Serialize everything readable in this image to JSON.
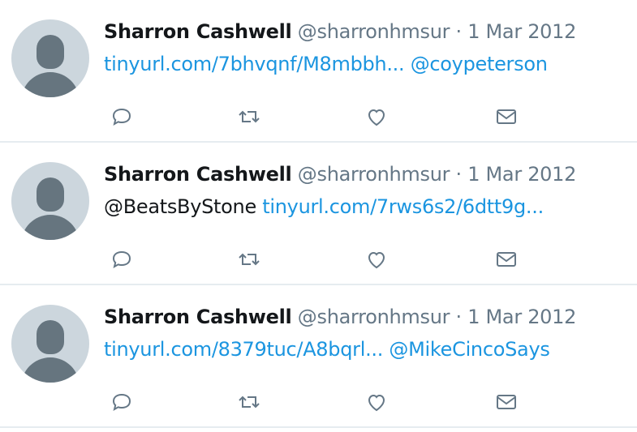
{
  "tweets": [
    {
      "name": "Sharron Cashwell",
      "handle": "@sharronhmsur",
      "separator": "·",
      "date": "1 Mar 2012",
      "text_parts": [
        {
          "text": "tinyurl.com/7bhvqnf/M8mbbh...",
          "type": "link"
        },
        {
          "text": " ",
          "type": "space"
        },
        {
          "text": "@coypeterson",
          "type": "link"
        }
      ]
    },
    {
      "name": "Sharron Cashwell",
      "handle": "@sharronhmsur",
      "separator": "·",
      "date": "1 Mar 2012",
      "text_parts": [
        {
          "text": "@BeatsByStone",
          "type": "plain"
        },
        {
          "text": "  ",
          "type": "space"
        },
        {
          "text": "tinyurl.com/7rws6s2/6dtt9g...",
          "type": "link"
        }
      ]
    },
    {
      "name": "Sharron Cashwell",
      "handle": "@sharronhmsur",
      "separator": "·",
      "date": "1 Mar 2012",
      "text_parts": [
        {
          "text": "tinyurl.com/8379tuc/A8bqrl...",
          "type": "link"
        },
        {
          "text": " ",
          "type": "space"
        },
        {
          "text": "@MikeCincoSays",
          "type": "link"
        }
      ]
    }
  ],
  "actions": {
    "reply_icon": "reply-icon",
    "retweet_icon": "retweet-icon",
    "like_icon": "heart-icon",
    "message_icon": "mail-icon"
  },
  "colors": {
    "link": "#1b95e0",
    "name": "#14171a",
    "secondary": "#657786",
    "divider": "#e6ecf0",
    "avatar_bg": "#ccd6dd",
    "avatar_fg": "#66757f"
  }
}
